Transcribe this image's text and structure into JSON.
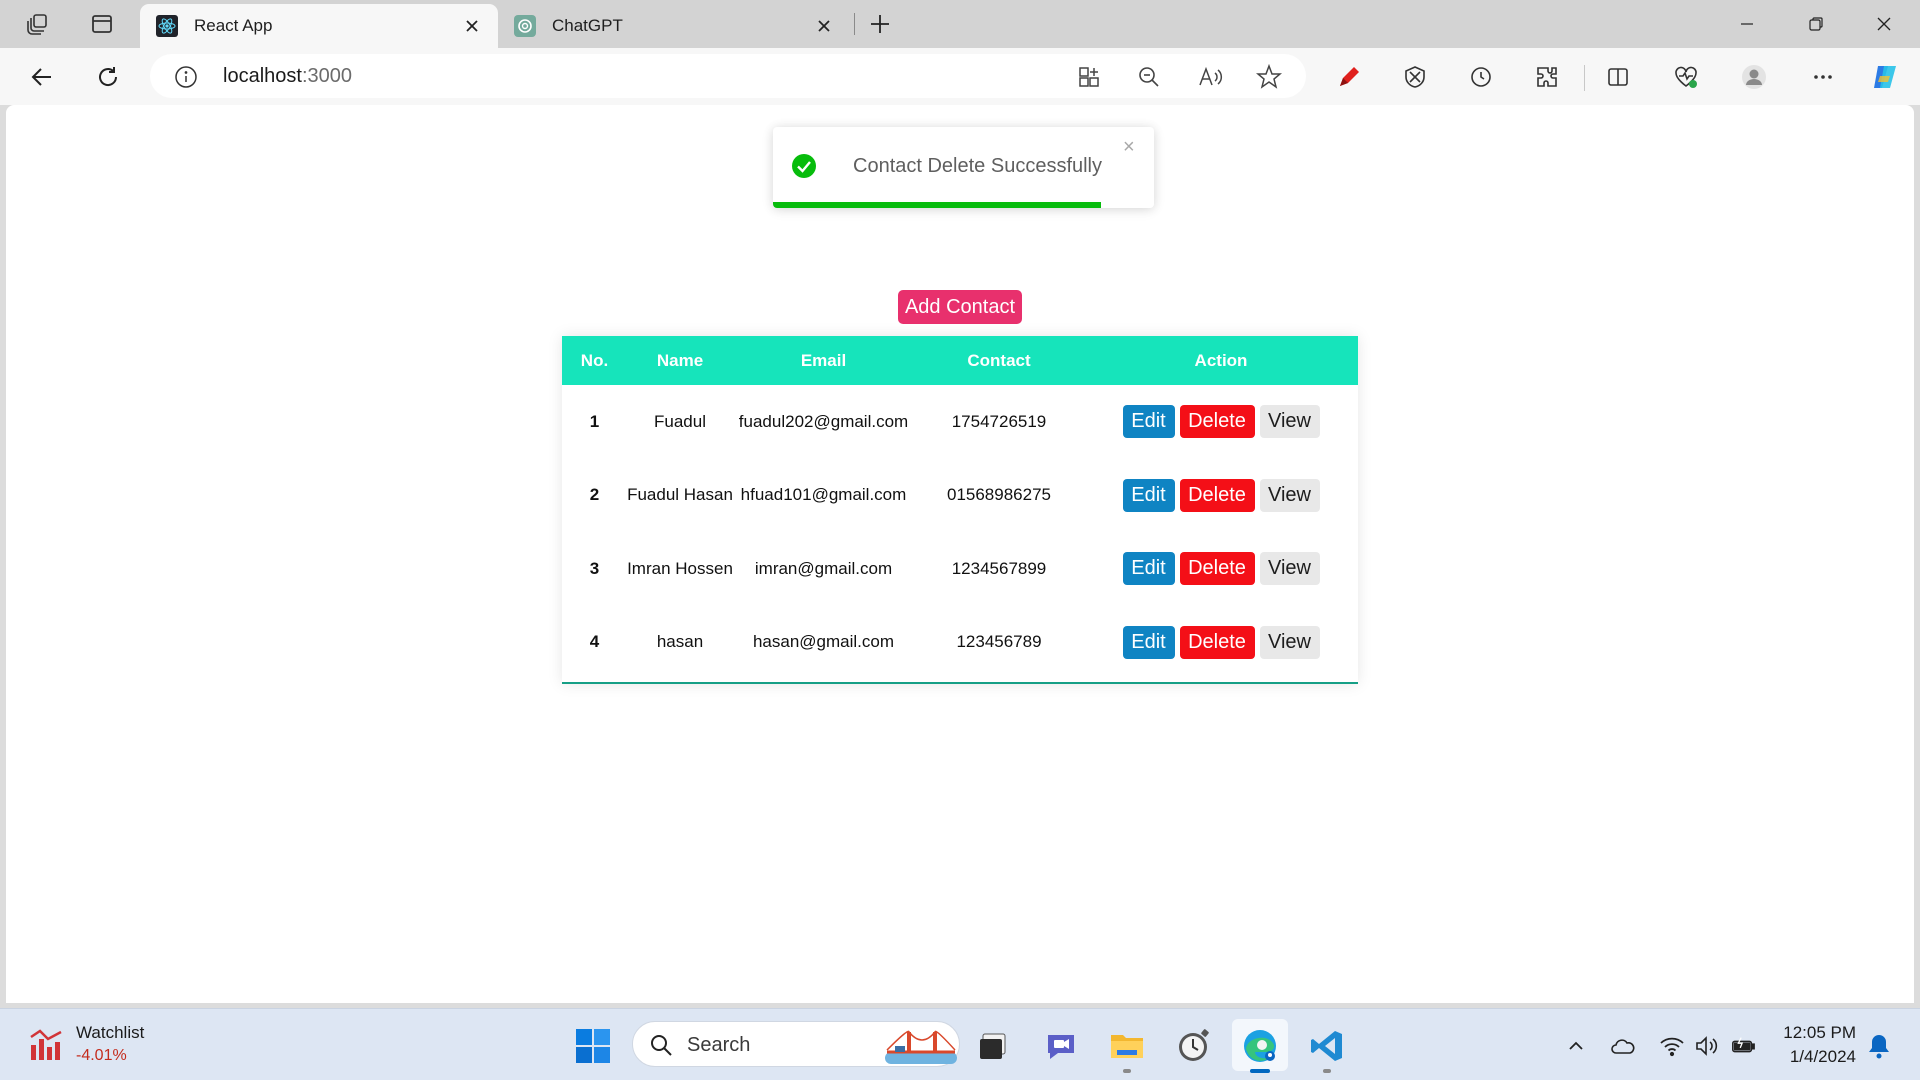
{
  "browser": {
    "tabs": [
      {
        "title": "React App",
        "active": true
      },
      {
        "title": "ChatGPT",
        "active": false
      }
    ],
    "address": {
      "host": "localhost",
      "port": ":3000"
    }
  },
  "toast": {
    "message": "Contact Delete Successfully",
    "close_symbol": "×",
    "progress": 0.86,
    "color": "#07bc0c"
  },
  "page": {
    "add_button_label": "Add Contact",
    "accent_color": "#e8306d",
    "table": {
      "header_color": "#16e4bb",
      "columns": [
        "No.",
        "Name",
        "Email",
        "Contact",
        "Action"
      ],
      "rows": [
        {
          "no": "1",
          "name": "Fuadul",
          "email": "fuadul202@gmail.com",
          "contact": "1754726519"
        },
        {
          "no": "2",
          "name": "Fuadul Hasan",
          "email": "hfuad101@gmail.com",
          "contact": "01568986275"
        },
        {
          "no": "3",
          "name": "Imran Hossen",
          "email": "imran@gmail.com",
          "contact": "1234567899"
        },
        {
          "no": "4",
          "name": "hasan",
          "email": "hasan@gmail.com",
          "contact": "123456789"
        }
      ],
      "actions": {
        "edit": "Edit",
        "delete": "Delete",
        "view": "View"
      }
    }
  },
  "taskbar": {
    "watchlist": {
      "title": "Watchlist",
      "value": "-4.01%"
    },
    "search_placeholder": "Search",
    "clock": {
      "time": "12:05 PM",
      "date": "1/4/2024"
    }
  }
}
